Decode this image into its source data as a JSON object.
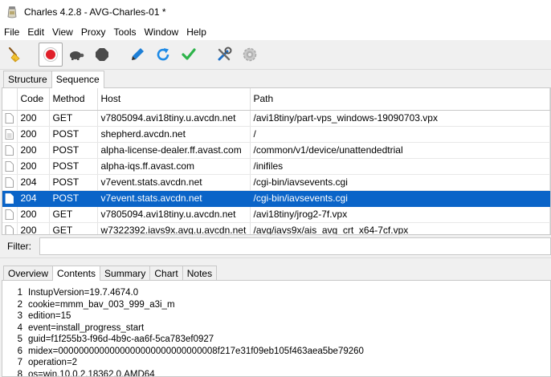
{
  "window": {
    "title": "Charles 4.2.8 - AVG-Charles-01 *"
  },
  "menu": [
    "File",
    "Edit",
    "View",
    "Proxy",
    "Tools",
    "Window",
    "Help"
  ],
  "toolbar": {
    "icons": [
      "broom-icon",
      "record-icon",
      "turtle-icon",
      "stop-icon",
      "pen-icon",
      "refresh-icon",
      "check-icon",
      "tools-icon",
      "settings-icon"
    ],
    "colors": {
      "record": "#e0202a",
      "refresh": "#1e8ae6",
      "check": "#2db34a",
      "pen": "#1e7fd6"
    }
  },
  "top_tabs": [
    {
      "label": "Structure",
      "selected": false
    },
    {
      "label": "Sequence",
      "selected": true
    }
  ],
  "table": {
    "columns": [
      "",
      "Code",
      "Method",
      "Host",
      "Path"
    ],
    "rows": [
      {
        "code": "200",
        "method": "GET",
        "host": "v7805094.avi18tiny.u.avcdn.net",
        "path": "/avi18tiny/part-vps_windows-19090703.vpx",
        "selected": false
      },
      {
        "code": "200",
        "method": "POST",
        "host": "shepherd.avcdn.net",
        "path": "/",
        "selected": false
      },
      {
        "code": "200",
        "method": "POST",
        "host": "alpha-license-dealer.ff.avast.com",
        "path": "/common/v1/device/unattendedtrial",
        "selected": false
      },
      {
        "code": "200",
        "method": "POST",
        "host": "alpha-iqs.ff.avast.com",
        "path": "/inifiles",
        "selected": false
      },
      {
        "code": "204",
        "method": "POST",
        "host": "v7event.stats.avcdn.net",
        "path": "/cgi-bin/iavsevents.cgi",
        "selected": false
      },
      {
        "code": "204",
        "method": "POST",
        "host": "v7event.stats.avcdn.net",
        "path": "/cgi-bin/iavsevents.cgi",
        "selected": true
      },
      {
        "code": "200",
        "method": "GET",
        "host": "v7805094.avi18tiny.u.avcdn.net",
        "path": "/avi18tiny/jrog2-7f.vpx",
        "selected": false
      },
      {
        "code": "200",
        "method": "GET",
        "host": "w7322392.iavs9x.avg.u.avcdn.net",
        "path": "/avg/iavs9x/ais_avg_crt_x64-7cf.vpx",
        "selected": false
      }
    ]
  },
  "filter": {
    "label": "Filter:",
    "value": ""
  },
  "bottom_tabs": [
    {
      "label": "Overview",
      "selected": false
    },
    {
      "label": "Contents",
      "selected": true
    },
    {
      "label": "Summary",
      "selected": false
    },
    {
      "label": "Chart",
      "selected": false
    },
    {
      "label": "Notes",
      "selected": false
    }
  ],
  "contents": {
    "lines": [
      {
        "n": "1",
        "text": "InstupVersion=19.7.4674.0"
      },
      {
        "n": "2",
        "text": "cookie=mmm_bav_003_999_a3i_m"
      },
      {
        "n": "3",
        "text": "edition=15"
      },
      {
        "n": "4",
        "text": "event=install_progress_start"
      },
      {
        "n": "5",
        "text": "guid=f1f255b3-f96d-4b9c-aa6f-5ca783ef0927"
      },
      {
        "n": "6",
        "text": "midex=0000000000000000000000000000008f217e31f09eb105f463aea5be79260"
      },
      {
        "n": "7",
        "text": "operation=2"
      },
      {
        "n": "8",
        "text": "os=win,10,0,2,18362,0,AMD64"
      }
    ]
  },
  "selection_color": "#0a64c8"
}
